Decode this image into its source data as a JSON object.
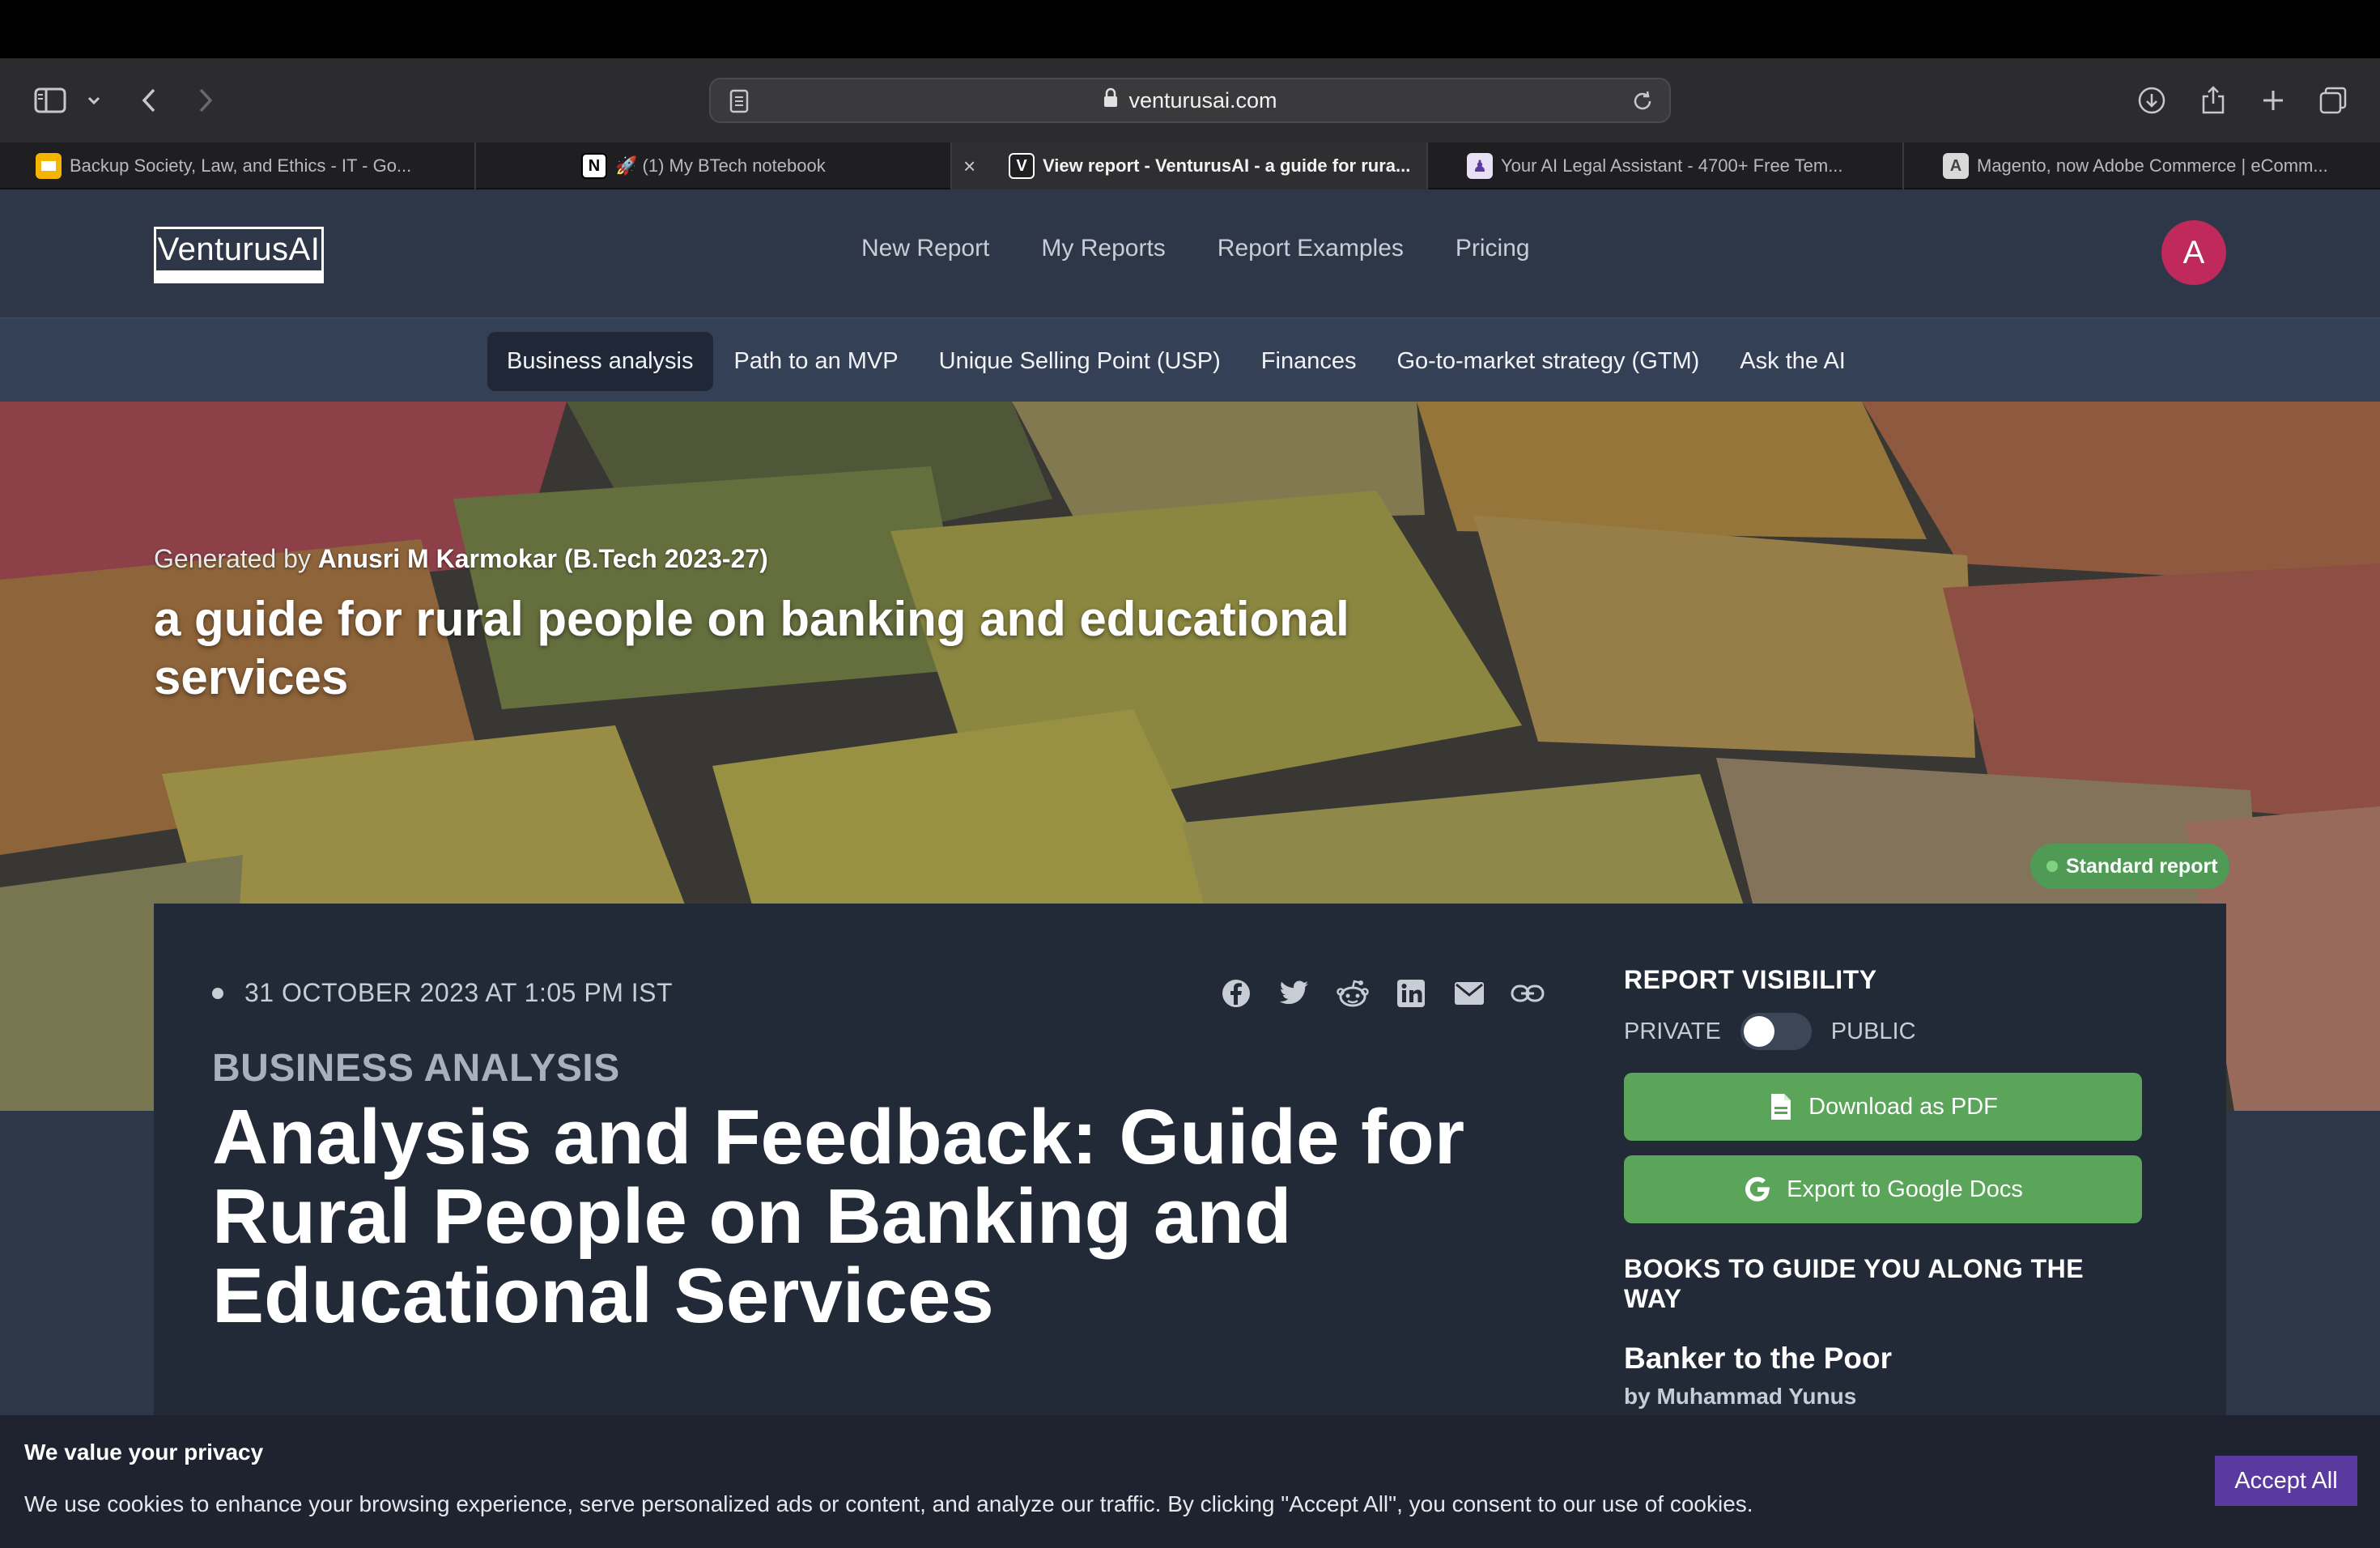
{
  "browser": {
    "url": "venturusai.com",
    "tabs": [
      {
        "label": "Backup Society, Law, and Ethics - IT - Go...",
        "icon": "slides-icon"
      },
      {
        "label": "🚀 (1) My BTech notebook",
        "icon": "notion-icon"
      },
      {
        "label": "View report - VenturusAI - a guide for rura...",
        "icon": "venturus-icon"
      },
      {
        "label": "Your AI Legal Assistant - 4700+ Free Tem...",
        "icon": "legal-icon"
      },
      {
        "label": "Magento, now Adobe Commerce | eComm...",
        "icon": "adobe-icon"
      }
    ]
  },
  "site": {
    "logo": "VenturusAI",
    "nav": [
      "New Report",
      "My Reports",
      "Report Examples",
      "Pricing"
    ],
    "avatar_initial": "A",
    "subnav": [
      "Business analysis",
      "Path to an MVP",
      "Unique Selling Point (USP)",
      "Finances",
      "Go-to-market strategy (GTM)",
      "Ask the AI"
    ]
  },
  "hero": {
    "generated_prefix": "Generated by ",
    "author": "Anusri M Karmokar (B.Tech 2023-27)",
    "title": "a guide for rural people on banking and educational services",
    "badge": "Standard report"
  },
  "article": {
    "date": "31 OCTOBER 2023 AT 1:05 PM IST",
    "section": "BUSINESS ANALYSIS",
    "title": "Analysis and Feedback: Guide for Rural People on Banking and Educational Services"
  },
  "sidebar": {
    "visibility_heading": "REPORT VISIBILITY",
    "private_label": "PRIVATE",
    "public_label": "PUBLIC",
    "download_pdf": "Download as PDF",
    "export_docs": "Export to Google Docs",
    "books_heading": "BOOKS TO GUIDE YOU ALONG THE WAY",
    "book_title": "Banker to the Poor",
    "book_author": "by Muhammad Yunus"
  },
  "cookie": {
    "heading": "We value your privacy",
    "text": "We use cookies to enhance your browsing experience, serve personalized ads or content, and analyze our traffic. By clicking \"Accept All\", you consent to our use of cookies.",
    "accept": "Accept All"
  },
  "colors": {
    "header_bg": "#2d3748",
    "accent_green": "#5aa55a",
    "avatar_red": "#c0295b",
    "accept_purple": "#5b3aa0"
  }
}
